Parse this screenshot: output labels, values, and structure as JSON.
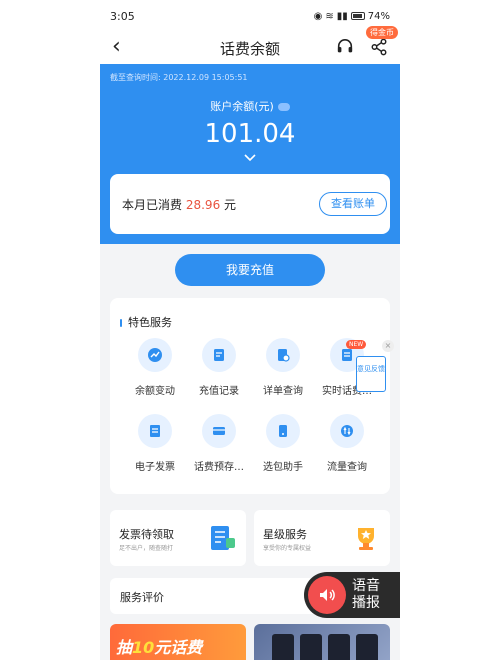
{
  "status_bar": {
    "time": "3:05",
    "battery": "74%"
  },
  "nav": {
    "back_glyph": "‹",
    "title": "话费余额",
    "badge": "得金币"
  },
  "balance": {
    "query_time": "截至查询时间: 2022.12.09 15:05:51",
    "label": "账户余额(元)",
    "value": "101.04"
  },
  "consume": {
    "prefix": "本月已消费",
    "amount": "28.96",
    "unit": "元",
    "button": "查看账单"
  },
  "recharge_button": "我要充值",
  "features": {
    "title": "特色服务",
    "new_tag": "NEW",
    "feedback_label": "意见反馈",
    "close_glyph": "×",
    "items": [
      {
        "label": "余额变动",
        "icon": "trend-icon"
      },
      {
        "label": "充值记录",
        "icon": "record-icon"
      },
      {
        "label": "详单查询",
        "icon": "detail-icon"
      },
      {
        "label": "实时话费…",
        "icon": "realtime-icon"
      },
      {
        "label": "电子发票",
        "icon": "invoice-icon"
      },
      {
        "label": "话费预存…",
        "icon": "card-icon"
      },
      {
        "label": "选包助手",
        "icon": "package-icon"
      },
      {
        "label": "流量查询",
        "icon": "traffic-icon"
      }
    ]
  },
  "promos": [
    {
      "title": "发票待领取",
      "subtitle": "足不出户，随查随打"
    },
    {
      "title": "星级服务",
      "subtitle": "享受你的专属权益"
    }
  ],
  "review": {
    "title": "服务评价"
  },
  "voice": {
    "line1": "语音",
    "line2": "播报"
  },
  "banner": {
    "prefix": "抽",
    "highlight": "10",
    "suffix": "元话费"
  },
  "colors": {
    "primary": "#2f8ff0",
    "accent_red": "#e8533f",
    "background": "#f3f4f6"
  }
}
